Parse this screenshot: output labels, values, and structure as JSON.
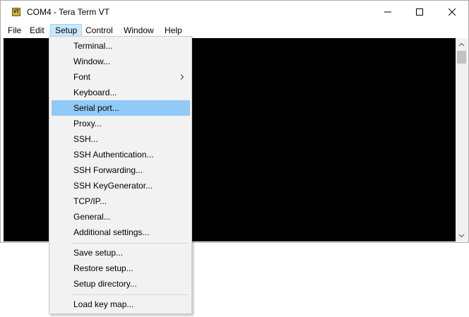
{
  "window": {
    "title": "COM4 - Tera Term VT",
    "icon": "vt-app-icon"
  },
  "menubar": {
    "items": [
      {
        "label": "File"
      },
      {
        "label": "Edit"
      },
      {
        "label": "Setup",
        "active": true
      },
      {
        "label": "Control"
      },
      {
        "label": "Window"
      },
      {
        "label": "Help"
      }
    ]
  },
  "setup_menu": {
    "groups": [
      [
        {
          "label": "Terminal..."
        },
        {
          "label": "Window..."
        },
        {
          "label": "Font",
          "submenu": true
        },
        {
          "label": "Keyboard..."
        },
        {
          "label": "Serial port...",
          "highlighted": true
        },
        {
          "label": "Proxy..."
        },
        {
          "label": "SSH..."
        },
        {
          "label": "SSH Authentication..."
        },
        {
          "label": "SSH Forwarding..."
        },
        {
          "label": "SSH KeyGenerator..."
        },
        {
          "label": "TCP/IP..."
        },
        {
          "label": "General..."
        },
        {
          "label": "Additional settings..."
        }
      ],
      [
        {
          "label": "Save setup..."
        },
        {
          "label": "Restore setup..."
        },
        {
          "label": "Setup directory..."
        }
      ],
      [
        {
          "label": "Load key map..."
        }
      ]
    ]
  },
  "colors": {
    "highlight": "#91c9f7",
    "terminal_bg": "#000000",
    "menu_active": "#cce8ff"
  }
}
